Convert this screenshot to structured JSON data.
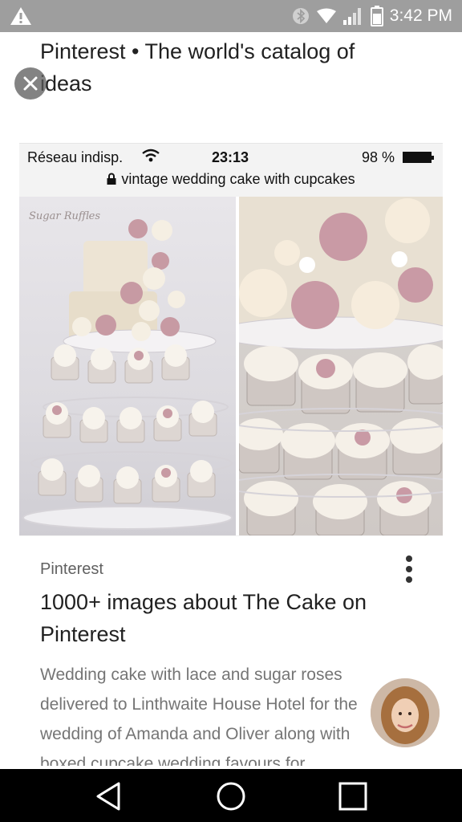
{
  "status_bar": {
    "time": "3:42 PM",
    "icons": [
      "warning-icon",
      "bluetooth-icon",
      "wifi-icon",
      "signal-icon",
      "battery-icon"
    ]
  },
  "header": {
    "title": "Pinterest • The world's catalog of ideas"
  },
  "screenshot_preview": {
    "status": {
      "carrier": "Réseau indisp.",
      "time": "23:13",
      "battery": "98 %"
    },
    "url": "vintage wedding cake with cupcakes",
    "watermark": "Sugar Ruffles"
  },
  "result": {
    "source": "Pinterest",
    "title": "1000+ images about The Cake on Pinterest",
    "description": "Wedding cake with lace and sugar roses delivered to Linthwaite House Hotel for the wedding of Amanda and Oliver along with boxed cupcake wedding favours for ..."
  },
  "nav": {
    "icons": [
      "back-icon",
      "home-icon",
      "recents-icon"
    ]
  },
  "colors": {
    "status_bar": "#9e9e9e",
    "nav_bar": "#000000",
    "rose_pink": "#c79aa3",
    "ivory": "#f3ece0"
  }
}
